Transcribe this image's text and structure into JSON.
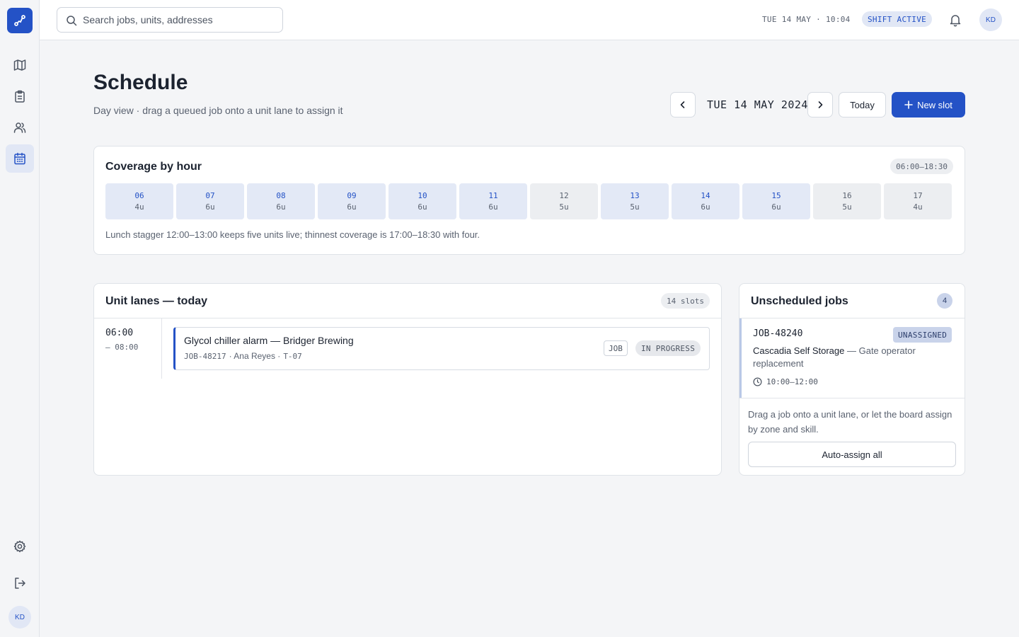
{
  "topbar": {
    "search_placeholder": "Search jobs, units, addresses",
    "datetime": "TUE 14 MAY · 10:04",
    "shift_status": "SHIFT ACTIVE",
    "avatar_initials": "KD"
  },
  "sidebar": {
    "items": [
      {
        "icon": "map-icon"
      },
      {
        "icon": "clipboard-icon"
      },
      {
        "icon": "users-icon"
      },
      {
        "icon": "calendar-icon",
        "active": true
      }
    ],
    "avatar_initials": "KD"
  },
  "header": {
    "title": "Schedule",
    "subtitle": "Day view · drag a queued job onto a unit lane to assign it",
    "date": "TUE 14 MAY 2024",
    "today_label": "Today",
    "new_slot_label": "New slot"
  },
  "coverage": {
    "title": "Coverage by hour",
    "range": "06:00–18:30",
    "hours": [
      {
        "hour": "06",
        "units": "4u",
        "full": true
      },
      {
        "hour": "07",
        "units": "6u",
        "full": true
      },
      {
        "hour": "08",
        "units": "6u",
        "full": true
      },
      {
        "hour": "09",
        "units": "6u",
        "full": true
      },
      {
        "hour": "10",
        "units": "6u",
        "full": true
      },
      {
        "hour": "11",
        "units": "6u",
        "full": true
      },
      {
        "hour": "12",
        "units": "5u",
        "full": false
      },
      {
        "hour": "13",
        "units": "5u",
        "full": true
      },
      {
        "hour": "14",
        "units": "6u",
        "full": true
      },
      {
        "hour": "15",
        "units": "6u",
        "full": true
      },
      {
        "hour": "16",
        "units": "5u",
        "full": false
      },
      {
        "hour": "17",
        "units": "4u",
        "full": false
      }
    ],
    "note": "Lunch stagger 12:00–13:00 keeps five units live; thinnest coverage is 17:00–18:30 with four."
  },
  "lanes": {
    "title": "Unit lanes — today",
    "slots": "14 slots",
    "rows": [
      {
        "start": "06:00",
        "end": "– 08:00",
        "job_title": "Glycol chiller alarm — Bridger Brewing",
        "job_id": "JOB-48217",
        "tech": "· Ana Reyes ·",
        "unit": "T-07",
        "tag": "JOB",
        "status": "IN PROGRESS"
      }
    ]
  },
  "unscheduled": {
    "title": "Unscheduled jobs",
    "count": "4",
    "item": {
      "id": "JOB-48240",
      "badge": "UNASSIGNED",
      "customer": "Cascadia Self Storage",
      "task": "— Gate operator replacement",
      "window": "10:00–12:00"
    },
    "help": "Drag a job onto a unit lane, or let the board assign by zone and skill.",
    "auto_assign_label": "Auto-assign all"
  },
  "colors": {
    "accent": "#2452c6",
    "accent_soft": "#e1e7f5",
    "background": "#f4f5f7"
  }
}
